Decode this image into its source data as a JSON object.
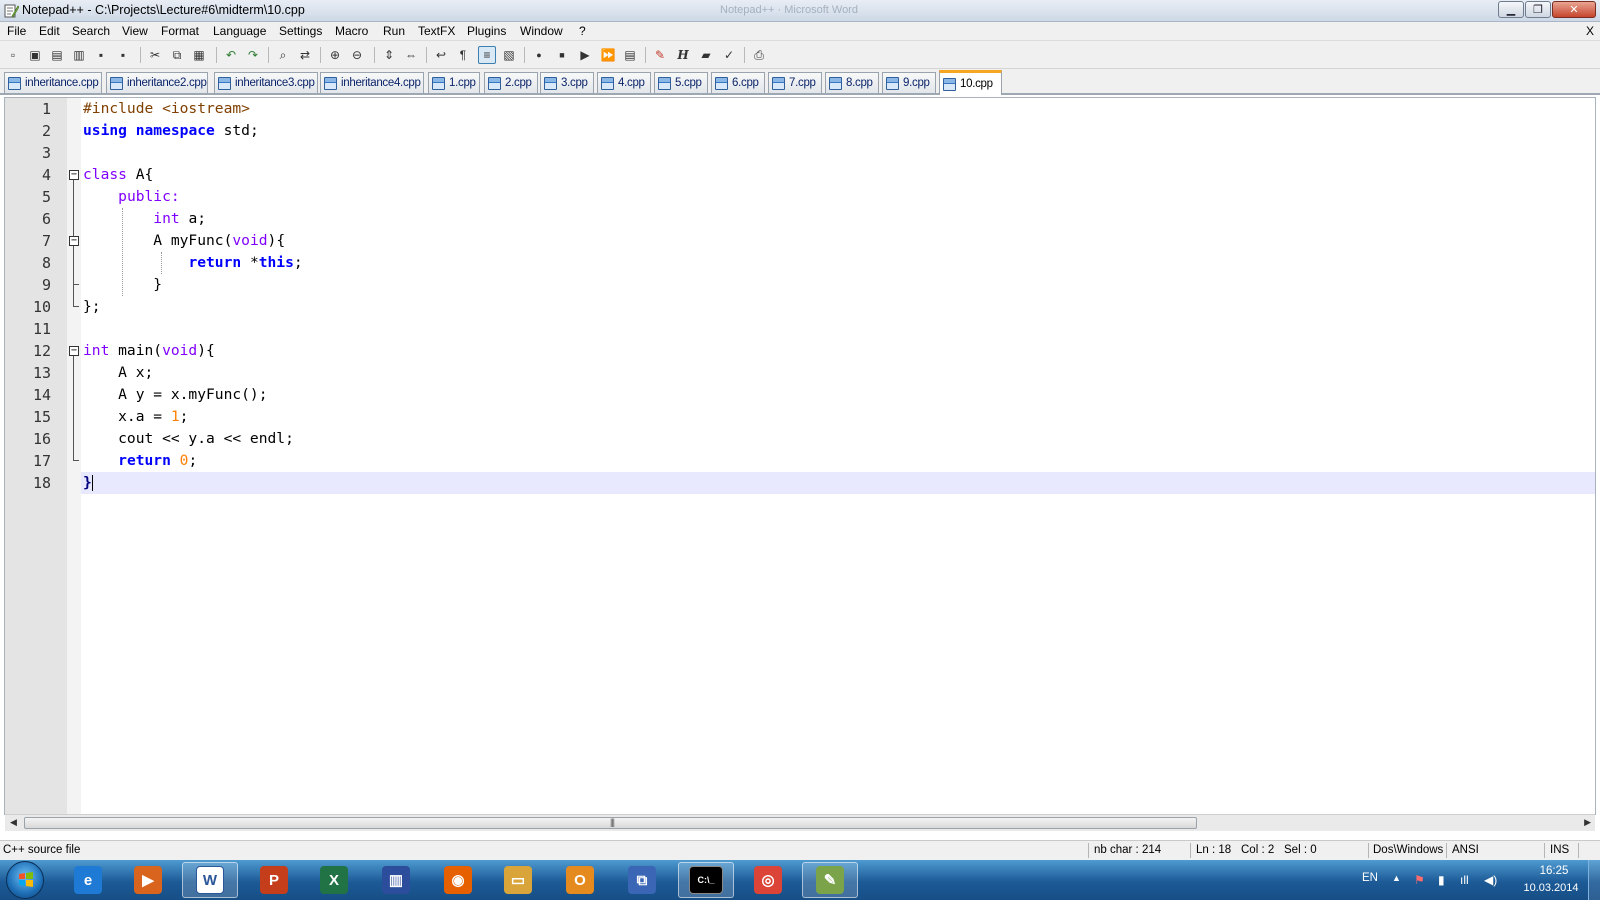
{
  "window": {
    "title": "Notepad++ - C:\\Projects\\Lecture#6\\midterm\\10.cpp",
    "ghost_title": "Notepad++ · Microsoft Word",
    "minimize": "▁",
    "maximize": "❐",
    "close": "✕"
  },
  "menu": {
    "items": [
      "File",
      "Edit",
      "Search",
      "View",
      "Format",
      "Language",
      "Settings",
      "Macro",
      "Run",
      "TextFX",
      "Plugins",
      "Window",
      "?"
    ],
    "close_doc": "X"
  },
  "toolbar": {
    "buttons": [
      "new",
      "open",
      "save",
      "save-all",
      "close",
      "close-all",
      "cut",
      "copy",
      "paste",
      "undo",
      "redo",
      "find",
      "replace",
      "zoom-in",
      "zoom-out",
      "sync-v",
      "sync-h",
      "word-wrap",
      "show-all-chars",
      "indent-guide",
      "user-lang",
      "record-macro",
      "stop-record",
      "play-macro",
      "run-multiple",
      "save-macro",
      "pdf",
      "html",
      "folder",
      "spellcheck",
      "print"
    ],
    "glyphs": {
      "new": "▫",
      "open": "▣",
      "save": "▤",
      "save-all": "▥",
      "close": "▪",
      "close-all": "▪",
      "cut": "✂",
      "copy": "⧉",
      "paste": "▦",
      "undo": "↶",
      "redo": "↷",
      "find": "⌕",
      "replace": "⇄",
      "zoom-in": "⊕",
      "zoom-out": "⊖",
      "sync-v": "⇕",
      "sync-h": "⇔",
      "word-wrap": "↩",
      "show-all-chars": "¶",
      "indent-guide": "≡",
      "user-lang": "▧",
      "record-macro": "●",
      "stop-record": "■",
      "play-macro": "▶",
      "run-multiple": "⏩",
      "save-macro": "▤",
      "pdf": "✎",
      "html": "H",
      "folder": "▰",
      "spellcheck": "✓",
      "print": "⎙"
    }
  },
  "tabs": [
    {
      "label": "inheritance.cpp",
      "active": false
    },
    {
      "label": "inheritance2.cpp",
      "active": false
    },
    {
      "label": "inheritance3.cpp",
      "active": false
    },
    {
      "label": "inheritance4.cpp",
      "active": false
    },
    {
      "label": "1.cpp",
      "active": false
    },
    {
      "label": "2.cpp",
      "active": false
    },
    {
      "label": "3.cpp",
      "active": false
    },
    {
      "label": "4.cpp",
      "active": false
    },
    {
      "label": "5.cpp",
      "active": false
    },
    {
      "label": "6.cpp",
      "active": false
    },
    {
      "label": "7.cpp",
      "active": false
    },
    {
      "label": "8.cpp",
      "active": false
    },
    {
      "label": "9.cpp",
      "active": false
    },
    {
      "label": "10.cpp",
      "active": true
    }
  ],
  "editor": {
    "line_numbers": [
      "1",
      "2",
      "3",
      "4",
      "5",
      "6",
      "7",
      "8",
      "9",
      "10",
      "11",
      "12",
      "13",
      "14",
      "15",
      "16",
      "17",
      "18"
    ],
    "current_line": 18,
    "lines": [
      [
        {
          "t": "#include <iostream>",
          "c": "pp"
        }
      ],
      [
        {
          "t": "using",
          "c": "kw"
        },
        {
          "t": " "
        },
        {
          "t": "namespace",
          "c": "kw"
        },
        {
          "t": " std;"
        }
      ],
      [],
      [
        {
          "t": "class",
          "c": "kw2"
        },
        {
          "t": " A{"
        }
      ],
      [
        {
          "t": "    "
        },
        {
          "t": "public:",
          "c": "kw2"
        }
      ],
      [
        {
          "t": "        "
        },
        {
          "t": "int",
          "c": "kw2"
        },
        {
          "t": " a;"
        }
      ],
      [
        {
          "t": "        A myFunc("
        },
        {
          "t": "void",
          "c": "kw2"
        },
        {
          "t": "){"
        }
      ],
      [
        {
          "t": "            "
        },
        {
          "t": "return",
          "c": "kw"
        },
        {
          "t": " *"
        },
        {
          "t": "this",
          "c": "kw"
        },
        {
          "t": ";"
        }
      ],
      [
        {
          "t": "        }"
        }
      ],
      [
        {
          "t": "};"
        }
      ],
      [],
      [
        {
          "t": "int",
          "c": "kw2"
        },
        {
          "t": " main("
        },
        {
          "t": "void",
          "c": "kw2"
        },
        {
          "t": "){"
        }
      ],
      [
        {
          "t": "    A x;"
        }
      ],
      [
        {
          "t": "    A y = x.myFunc();"
        }
      ],
      [
        {
          "t": "    x.a = "
        },
        {
          "t": "1",
          "c": "num"
        },
        {
          "t": ";"
        }
      ],
      [
        {
          "t": "    cout << y.a << endl;"
        }
      ],
      [
        {
          "t": "    "
        },
        {
          "t": "return",
          "c": "kw"
        },
        {
          "t": " "
        },
        {
          "t": "0",
          "c": "num"
        },
        {
          "t": ";"
        }
      ],
      [
        {
          "t": "}",
          "c": "br"
        }
      ]
    ]
  },
  "hscroll": {
    "left_arrow": "◀",
    "right_arrow": "▶",
    "grip": "|||"
  },
  "status": {
    "file_type": "C++ source file",
    "nb_char": "nb char : 214",
    "ln": "Ln : 18",
    "col": "Col : 2",
    "sel": "Sel : 0",
    "eol": "Dos\\Windows",
    "encoding": "ANSI",
    "mode": "INS"
  },
  "taskbar": {
    "apps": [
      {
        "name": "internet-explorer",
        "glyph": "e",
        "color": "#1f7ad6",
        "open": false
      },
      {
        "name": "media-player",
        "glyph": "▶",
        "color": "#d9641e",
        "open": false
      },
      {
        "name": "word",
        "glyph": "W",
        "color": "#2b579a",
        "open": true
      },
      {
        "name": "powerpoint",
        "glyph": "P",
        "color": "#c43e1c",
        "open": false
      },
      {
        "name": "excel",
        "glyph": "X",
        "color": "#217346",
        "open": false
      },
      {
        "name": "books",
        "glyph": "▥",
        "color": "#2b4d9c",
        "open": false
      },
      {
        "name": "firefox",
        "glyph": "◉",
        "color": "#e66000",
        "open": false
      },
      {
        "name": "explorer",
        "glyph": "▭",
        "color": "#d9a53b",
        "open": false
      },
      {
        "name": "outlook",
        "glyph": "O",
        "color": "#e58a1f",
        "open": false
      },
      {
        "name": "visual-studio",
        "glyph": "⧉",
        "color": "#3a66b5",
        "open": false
      },
      {
        "name": "cmd",
        "glyph": "C:\\_",
        "color": "#000000",
        "open": true
      },
      {
        "name": "chrome",
        "glyph": "◎",
        "color": "#db4437",
        "open": false
      },
      {
        "name": "notepad-plus-plus",
        "glyph": "✎",
        "color": "#7aa34a",
        "open": true
      }
    ],
    "tray": {
      "language": "EN",
      "icons": [
        "▲",
        "⚑",
        "▮",
        "ıll",
        "◀)"
      ],
      "time": "16:25",
      "date": "10.03.2014"
    }
  }
}
